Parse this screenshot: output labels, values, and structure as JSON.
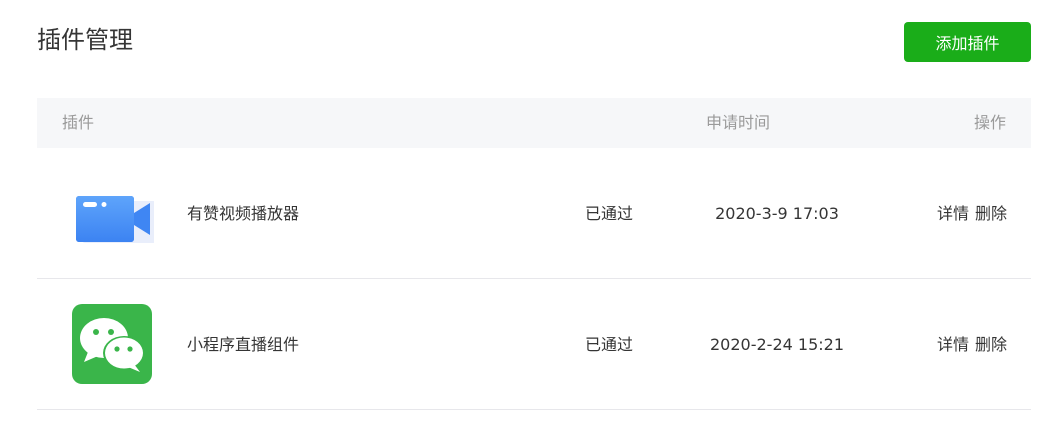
{
  "header": {
    "title": "插件管理",
    "add_button_label": "添加插件"
  },
  "table": {
    "columns": {
      "plugin": "插件",
      "apply_time": "申请时间",
      "actions": "操作"
    },
    "rows": [
      {
        "icon": "video-camera-icon",
        "name": "有赞视频播放器",
        "status": "已通过",
        "time": "2020-3-9 17:03",
        "detail_label": "详情",
        "delete_label": "删除"
      },
      {
        "icon": "wechat-icon",
        "name": "小程序直播组件",
        "status": "已通过",
        "time": "2020-2-24 15:21",
        "detail_label": "详情",
        "delete_label": "删除"
      }
    ]
  },
  "colors": {
    "primary_green": "#1aad19",
    "link_blue": "#576b95",
    "header_bg": "#f6f7f9"
  }
}
